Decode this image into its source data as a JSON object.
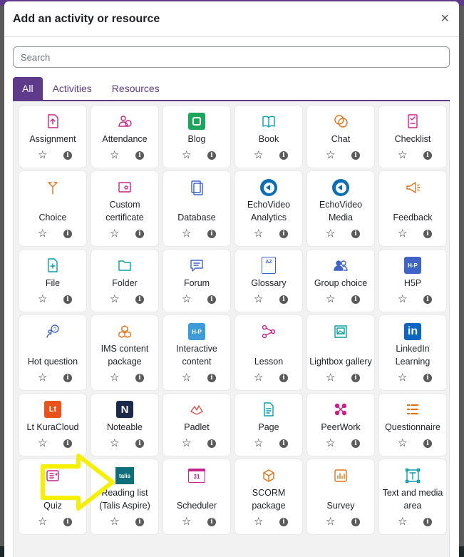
{
  "modal": {
    "title": "Add an activity or resource",
    "close": "×",
    "search_placeholder": "Search"
  },
  "tabs": [
    "All",
    "Activities",
    "Resources"
  ],
  "colors": {
    "brand": "#5e3b8a",
    "annotation_arrow": "#f5f000"
  },
  "items": [
    {
      "label": "Assignment",
      "icon": "assignment-icon"
    },
    {
      "label": "Attendance",
      "icon": "attendance-icon"
    },
    {
      "label": "Blog",
      "icon": "blog-icon"
    },
    {
      "label": "Book",
      "icon": "book-icon"
    },
    {
      "label": "Chat",
      "icon": "chat-icon"
    },
    {
      "label": "Checklist",
      "icon": "checklist-icon"
    },
    {
      "label": "Choice",
      "icon": "choice-icon"
    },
    {
      "label": "Custom certificate",
      "icon": "certificate-icon"
    },
    {
      "label": "Database",
      "icon": "database-icon"
    },
    {
      "label": "EchoVideo Analytics",
      "icon": "echovideo-icon"
    },
    {
      "label": "EchoVideo Media",
      "icon": "echovideo-icon"
    },
    {
      "label": "Feedback",
      "icon": "megaphone-icon"
    },
    {
      "label": "File",
      "icon": "file-icon"
    },
    {
      "label": "Folder",
      "icon": "folder-icon"
    },
    {
      "label": "Forum",
      "icon": "forum-icon"
    },
    {
      "label": "Glossary",
      "icon": "glossary-icon"
    },
    {
      "label": "Group choice",
      "icon": "group-icon"
    },
    {
      "label": "H5P",
      "icon": "h5p-icon"
    },
    {
      "label": "Hot question",
      "icon": "hot-question-icon"
    },
    {
      "label": "IMS content package",
      "icon": "package-icon"
    },
    {
      "label": "Interactive content",
      "icon": "h5p-block-icon"
    },
    {
      "label": "Lesson",
      "icon": "lesson-icon"
    },
    {
      "label": "Lightbox gallery",
      "icon": "gallery-icon"
    },
    {
      "label": "LinkedIn Learning",
      "icon": "linkedin-icon"
    },
    {
      "label": "Lt KuraCloud",
      "icon": "kuracloud-icon"
    },
    {
      "label": "Noteable",
      "icon": "noteable-icon"
    },
    {
      "label": "Padlet",
      "icon": "padlet-icon"
    },
    {
      "label": "Page",
      "icon": "page-icon"
    },
    {
      "label": "PeerWork",
      "icon": "peerwork-icon"
    },
    {
      "label": "Questionnaire",
      "icon": "questionnaire-icon"
    },
    {
      "label": "Quiz",
      "icon": "quiz-icon"
    },
    {
      "label": "Reading list (Talis Aspire)",
      "icon": "talis-icon",
      "icon_text": "talis"
    },
    {
      "label": "Scheduler",
      "icon": "scheduler-icon",
      "icon_text": "31"
    },
    {
      "label": "SCORM package",
      "icon": "scorm-icon"
    },
    {
      "label": "Survey",
      "icon": "survey-icon"
    },
    {
      "label": "Text and media area",
      "icon": "text-media-icon"
    }
  ],
  "icon_texts": {
    "h5p": "H-P",
    "linkedin": "in",
    "kuracloud": "Lt",
    "noteable": "N",
    "glossary": "AZ",
    "h5p_block": "H-P"
  },
  "glyphs": {
    "star": "☆",
    "info": "i"
  }
}
